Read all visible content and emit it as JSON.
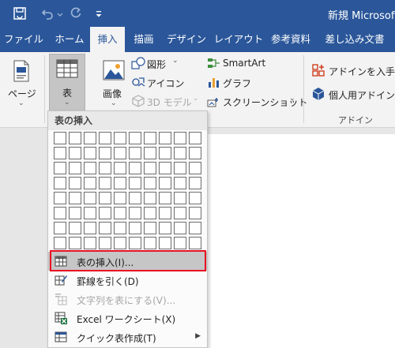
{
  "titlebar": {
    "title": "新規 Microsoft"
  },
  "tabs": [
    "ファイル",
    "ホーム",
    "挿入",
    "描画",
    "デザイン",
    "レイアウト",
    "参考資料",
    "差し込み文書"
  ],
  "ribbon": {
    "page_label": "ページ",
    "table_label": "表",
    "image_label": "画像",
    "shapes_label": "図形",
    "icons_label": "アイコン",
    "models3d_label": "3D モデル",
    "smartart_label": "SmartArt",
    "graph_label": "グラフ",
    "screenshot_label": "スクリーンショット",
    "addin_get_label": "アドインを入手",
    "addin_personal_label": "個人用アドイン",
    "addin_group_label": "アドイン"
  },
  "dropdown": {
    "header": "表の挿入",
    "grid_cols": 10,
    "grid_rows": 8,
    "items": [
      {
        "label": "表の挿入(I)..."
      },
      {
        "label": "罫線を引く(D)"
      },
      {
        "label": "文字列を表にする(V)..."
      },
      {
        "label": "Excel ワークシート(X)"
      },
      {
        "label": "クイック表作成(T)"
      }
    ]
  },
  "colors": {
    "accent": "#2b579a",
    "highlight_border": "#e81123"
  }
}
